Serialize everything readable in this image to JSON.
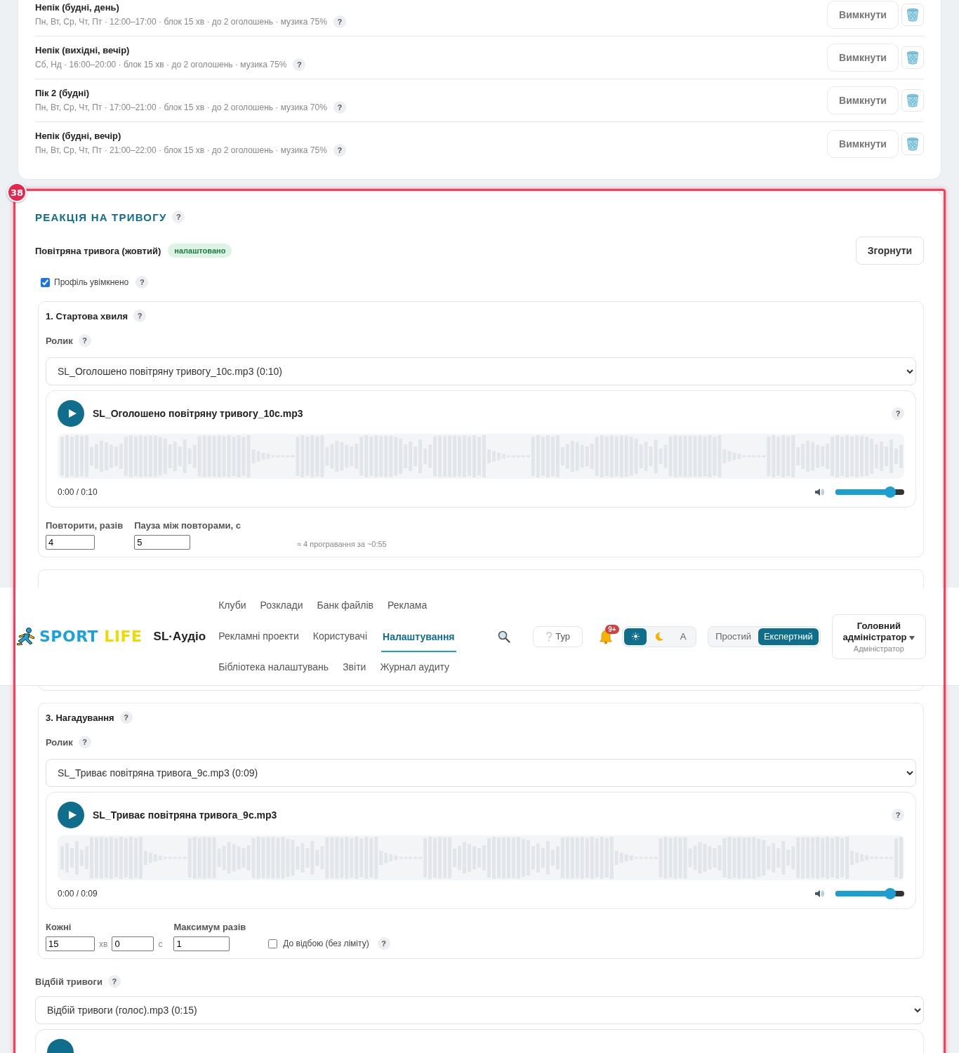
{
  "schedule_rows": [
    {
      "title": "Непік (будні, день)",
      "details": "Пн, Вт, Ср, Чт, Пт · 12:00–17:00 · блок 15 хв · до 2 оголошень · музика 75%",
      "help": "?",
      "toggle_button": "Вимкнути"
    },
    {
      "title": "Непік (вихідні, вечір)",
      "details": "Сб, Нд · 16:00–20:00 · блок 15 хв · до 2 оголошень · музика 75%",
      "help": "?",
      "toggle_button": "Вимкнути"
    },
    {
      "title": "Пік 2 (будні)",
      "details": "Пн, Вт, Ср, Чт, Пт · 17:00–21:00 · блок 15 хв · до 2 оголошень · музика 70%",
      "help": "?",
      "toggle_button": "Вимкнути"
    },
    {
      "title": "Непік (будні, вечір)",
      "details": "Пн, Вт, Ср, Чт, Пт · 21:00–22:00 · блок 15 хв · до 2 оголошень · музика 75%",
      "help": "?",
      "toggle_button": "Вимкнути"
    }
  ],
  "alarm_section": {
    "title": "РЕАКЦІЯ НА ТРИВОГУ",
    "help": "?",
    "profile": {
      "name": "Повітряна тривога (жовтий)",
      "status": "налаштовано",
      "collapse_button": "Згорнути"
    },
    "enabled": {
      "label": "Профіль увімкнено",
      "checked": true,
      "help": "?"
    },
    "stages": [
      {
        "kind": "repeat",
        "title": "1. Стартова хвиля",
        "help": "?",
        "clip_label": "Ролик",
        "clip_help": "?",
        "clip_select": "SL_Оголошено повітряну тривогу_10с.mp3 (0:10)",
        "player": {
          "filename": "SL_Оголошено повітряну тривогу_10с.mp3",
          "help": "?",
          "time": "0:00 / 0:10",
          "volume": {
            "level": 0.8
          }
        },
        "fields": [
          {
            "label": "Повторити, разів",
            "value": "4"
          },
          {
            "label": "Пауза між повторами, с",
            "value": "5"
          }
        ],
        "note": "≈ 4 програвання за ~0:55"
      },
      {
        "kind": "covered"
      },
      {
        "kind": "reminder",
        "title": "3. Нагадування",
        "help": "?",
        "clip_label": "Ролик",
        "clip_help": "?",
        "clip_select": "SL_Триває повітряна тривога_9с.mp3 (0:09)",
        "player": {
          "filename": "SL_Триває повітряна тривога_9с.mp3",
          "help": "?",
          "time": "0:00 / 0:09",
          "volume": {
            "level": 0.8
          }
        },
        "interval": {
          "label": "Кожні",
          "minutes": "15",
          "minutes_unit": "хв",
          "seconds": "0",
          "seconds_unit": "с"
        },
        "max": {
          "label": "Максимум разів",
          "value": "1"
        },
        "until_clear": {
          "label": "До відбою (без ліміту)",
          "checked": false,
          "help": "?"
        }
      }
    ],
    "all_clear": {
      "label": "Відбій тривоги",
      "help": "?",
      "clip_select": "Відбій тривоги (голос).mp3 (0:15)"
    }
  },
  "header": {
    "logo": {
      "word_1": "SPORT",
      "word_2": "LIFE"
    },
    "app_name": "SL·Аудіо",
    "nav_rows": [
      [
        {
          "label": "Клуби",
          "selected": false
        },
        {
          "label": "Розклади",
          "selected": false
        },
        {
          "label": "Банк файлів",
          "selected": false
        },
        {
          "label": "Реклама",
          "selected": false
        }
      ],
      [
        {
          "label": "Рекламні проекти",
          "selected": false
        },
        {
          "label": "Користувачі",
          "selected": false
        },
        {
          "label": "Налаштування",
          "selected": true
        }
      ],
      [
        {
          "label": "Бібліотека налаштувань",
          "selected": false
        },
        {
          "label": "Звіти",
          "selected": false
        },
        {
          "label": "Журнал аудиту",
          "selected": false
        }
      ]
    ],
    "tour_button": "Тур",
    "notifications_badge": "9+",
    "theme_options": [
      {
        "kind": "sun",
        "selected": true
      },
      {
        "kind": "moon",
        "selected": false
      },
      {
        "kind": "auto",
        "label": "A",
        "selected": false
      }
    ],
    "mode_options": [
      {
        "label": "Простий",
        "selected": false
      },
      {
        "label": "Експертний",
        "selected": true
      }
    ],
    "user": {
      "name": "Головний адміністратор",
      "role": "Адміністратор"
    }
  },
  "annotation": {
    "number": "38"
  }
}
